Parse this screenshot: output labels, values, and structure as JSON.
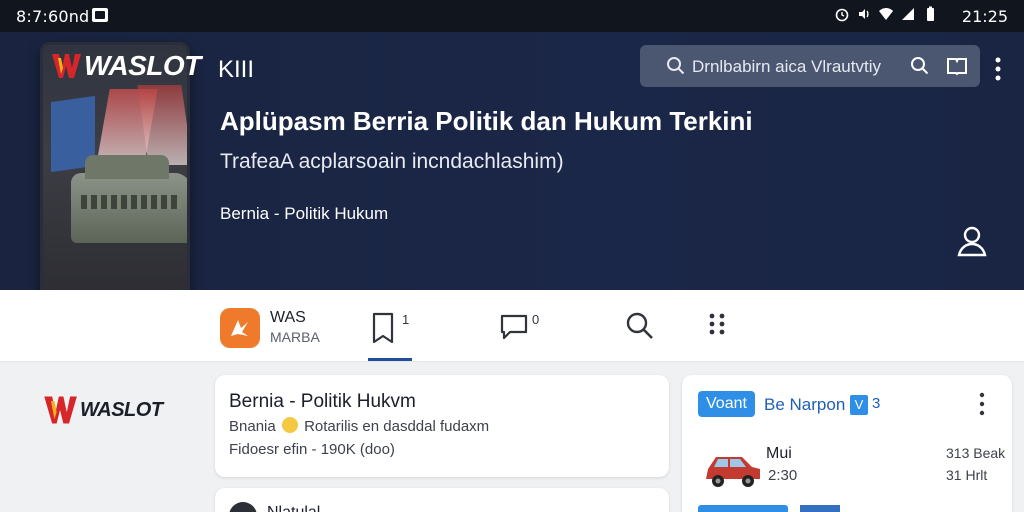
{
  "status_bar": {
    "time_left": "8:7:60nd",
    "time_right": "21:25",
    "icons": [
      "app-notification-icon",
      "alarm-icon",
      "sound-icon",
      "wifi-icon",
      "signal-icon",
      "battery-icon"
    ]
  },
  "header": {
    "logo_text": "WASLOT",
    "logo_suffix": "KIII",
    "search_placeholder": "Drnlbabirn aica Vlrautvtiy",
    "title": "Aplüpasm Berria Politik dan Hukum Terkini",
    "subtitle": "TrafeaA acplarsoain incndachlashim)",
    "category": "Bernia - Politik Hukum"
  },
  "nav": {
    "app_name": "WAS",
    "app_sub": "MARBA",
    "bookmark_count": "1",
    "chat_count": "0"
  },
  "side": {
    "logo_text": "WASLOT"
  },
  "articles": [
    {
      "title": "Bernia - Politik Hukvm",
      "snippet_a": "Bnania",
      "snippet_b": "Rotarilis en dasddal fudaxm",
      "meta": "Fidoesr efin - 190K (doo)"
    },
    {
      "title": "Nlatulal"
    }
  ],
  "panel": {
    "pill": "Voant",
    "label": "Be Narpon",
    "badge": "V",
    "badge_num": "3",
    "item_name": "Mui",
    "item_time": "2:30",
    "item_right1": "313 Beak",
    "item_right2": "31 Hrlt"
  },
  "colors": {
    "status_bg": "#11151d",
    "hero_bg": "#1a2440",
    "accent": "#2f8ee6",
    "app_icon": "#f07a2b",
    "underline": "#1f4f9a",
    "logo_red": "#d6262a",
    "logo_yellow": "#f4b21a"
  }
}
